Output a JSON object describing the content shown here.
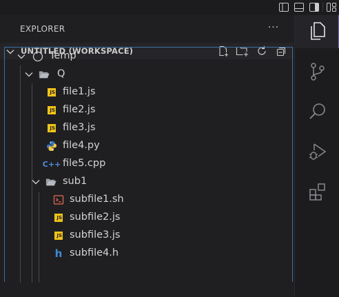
{
  "window": {
    "layout_toggles": [
      "toggle-primary-sidebar-icon",
      "toggle-panel-icon",
      "toggle-secondary-sidebar-icon",
      "customize-layout-icon"
    ]
  },
  "explorer": {
    "title": "EXPLORER",
    "more_label": "···"
  },
  "workspace": {
    "title": "UNTITLED (WORKSPACE)",
    "actions": [
      "new-file-icon",
      "new-folder-icon",
      "refresh-icon",
      "collapse-all-icon"
    ]
  },
  "tree": {
    "root": {
      "label": "Temp",
      "icon": "root-folder-circle-icon"
    },
    "q_folder": {
      "label": "Q",
      "icon": "open-folder-icon"
    },
    "files": [
      {
        "label": "file1.js",
        "icon": "javascript-file-icon"
      },
      {
        "label": "file2.js",
        "icon": "javascript-file-icon"
      },
      {
        "label": "file3.js",
        "icon": "javascript-file-icon"
      },
      {
        "label": "file4.py",
        "icon": "python-file-icon"
      },
      {
        "label": "file5.cpp",
        "icon": "cpp-file-icon"
      }
    ],
    "sub_folder": {
      "label": "sub1",
      "icon": "open-folder-icon"
    },
    "sub_files": [
      {
        "label": "subfile1.sh",
        "icon": "shell-file-icon"
      },
      {
        "label": "subfile2.js",
        "icon": "javascript-file-icon"
      },
      {
        "label": "subfile3.js",
        "icon": "javascript-file-icon"
      },
      {
        "label": "subfile4.h",
        "icon": "header-file-icon"
      }
    ]
  },
  "activity_bar": {
    "items": [
      "explorer-icon",
      "source-control-icon",
      "search-icon",
      "run-debug-icon",
      "extensions-icon"
    ],
    "active": "explorer-icon"
  },
  "colors": {
    "background": "#1f1f22",
    "focus_border": "#3d6fa3",
    "active_indicator": "#7b6bd6",
    "js_badge": "#f0c419"
  }
}
